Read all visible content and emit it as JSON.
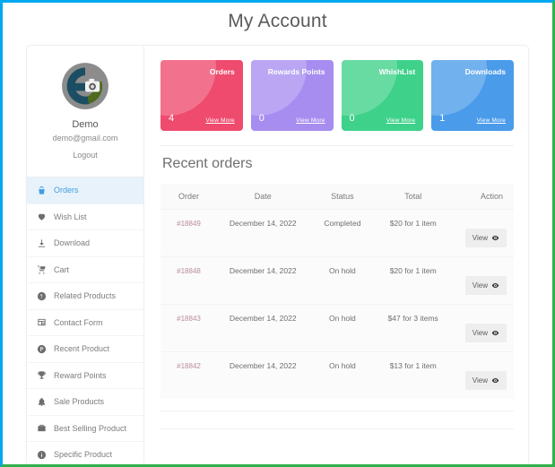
{
  "page": {
    "title": "My Account",
    "frame_color_top_left": "#00a8f0",
    "frame_color_right_bottom": "#2fb24c"
  },
  "sidebar": {
    "profile": {
      "avatar_icon": "camera-placeholder-avatar",
      "name": "Demo",
      "email": "demo@gmail.com",
      "logout_label": "Logout"
    },
    "items": [
      {
        "label": "Orders",
        "icon": "basket-icon",
        "active": true
      },
      {
        "label": "Wish List",
        "icon": "heart-icon",
        "active": false
      },
      {
        "label": "Download",
        "icon": "download-icon",
        "active": false
      },
      {
        "label": "Cart",
        "icon": "cart-icon",
        "active": false
      },
      {
        "label": "Related Products",
        "icon": "question-icon",
        "active": false
      },
      {
        "label": "Contact Form",
        "icon": "form-icon",
        "active": false
      },
      {
        "label": "Recent Product",
        "icon": "p-circle-icon",
        "active": false
      },
      {
        "label": "Reward Points",
        "icon": "trophy-icon",
        "active": false
      },
      {
        "label": "Sale Products",
        "icon": "bell-icon",
        "active": false
      },
      {
        "label": "Best Selling Product",
        "icon": "briefcase-icon",
        "active": false
      },
      {
        "label": "Specific Product",
        "icon": "info-icon",
        "active": false
      }
    ]
  },
  "cards": [
    {
      "label": "Orders",
      "count": "4",
      "more_label": "View More",
      "color": "#ef4b6e"
    },
    {
      "label": "Rewards Points",
      "count": "0",
      "more_label": "View More",
      "color": "#a78df0"
    },
    {
      "label": "WhishList",
      "count": "0",
      "more_label": "View More",
      "color": "#3ed18a"
    },
    {
      "label": "Downloads",
      "count": "1",
      "more_label": "View More",
      "color": "#4a9bea"
    }
  ],
  "recent_orders": {
    "heading": "Recent orders",
    "columns": [
      "Order",
      "Date",
      "Status",
      "Total",
      "Action"
    ],
    "rows": [
      {
        "order": "#18849",
        "date": "December 14, 2022",
        "status": "Completed",
        "total": "$20 for 1 item",
        "action_label": "View"
      },
      {
        "order": "#18848",
        "date": "December 14, 2022",
        "status": "On hold",
        "total": "$20 for 1 item",
        "action_label": "View"
      },
      {
        "order": "#18843",
        "date": "December 14, 2022",
        "status": "On hold",
        "total": "$47 for 3 items",
        "action_label": "View"
      },
      {
        "order": "#18842",
        "date": "December 14, 2022",
        "status": "On hold",
        "total": "$13 for 1 item",
        "action_label": "View"
      }
    ]
  }
}
